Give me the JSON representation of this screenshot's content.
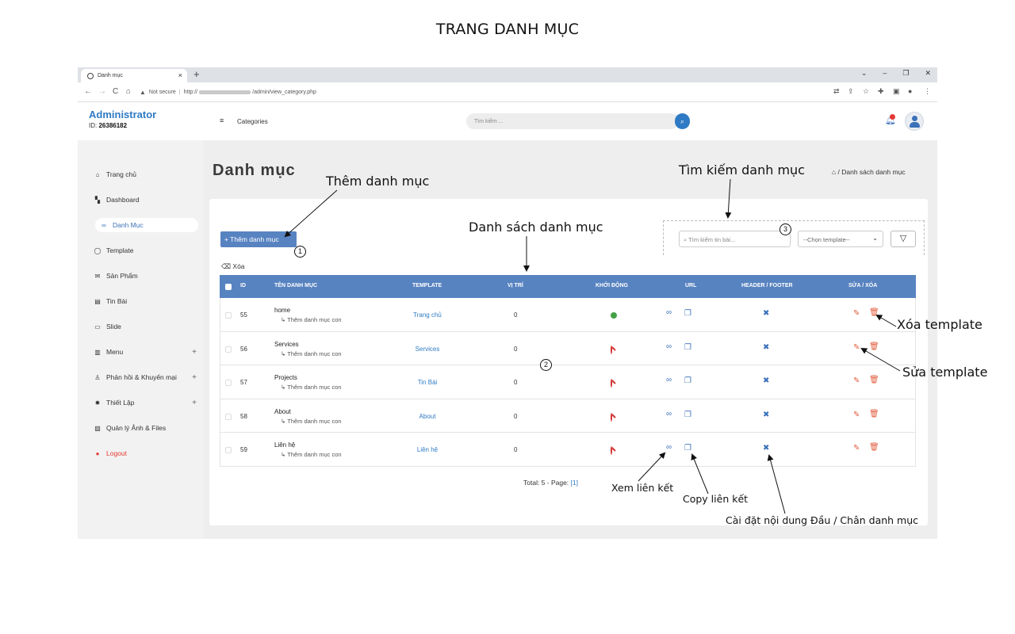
{
  "page_heading": "TRANG DANH MỤC",
  "browser": {
    "tab_title": "Danh mục",
    "tab_close": "×",
    "new_tab": "+",
    "window_controls": [
      "⌄",
      "–",
      "❐",
      "✕"
    ],
    "security": "Not secure",
    "url_prefix": "http://",
    "url_path": "/admin/view_category.php"
  },
  "header": {
    "admin_name": "Administrator",
    "admin_id_label": "ID:",
    "admin_id": "26386182",
    "section": "Categories",
    "search_placeholder": "Tìm kiếm ..."
  },
  "sidebar": {
    "items": [
      {
        "label": "Trang chủ",
        "icon": "home-icon"
      },
      {
        "label": "Dashboard",
        "icon": "dashboard-icon"
      },
      {
        "label": "Danh Mục",
        "icon": "link-icon",
        "active": true
      },
      {
        "label": "Template",
        "icon": "circle-icon"
      },
      {
        "label": "Sản Phẩm",
        "icon": "mail-icon"
      },
      {
        "label": "Tin Bài",
        "icon": "news-icon"
      },
      {
        "label": "Slide",
        "icon": "slide-icon"
      },
      {
        "label": "Menu",
        "icon": "menu-icon",
        "expand": "+"
      },
      {
        "label": "Phản hồi & Khuyến mại",
        "icon": "user-icon",
        "expand": "+"
      },
      {
        "label": "Thiết Lập",
        "icon": "gear-icon",
        "expand": "+"
      },
      {
        "label": "Quản lý Ảnh & Files",
        "icon": "images-icon"
      },
      {
        "label": "Logout",
        "icon": "logout-icon"
      }
    ]
  },
  "main": {
    "title": "Danh mục",
    "breadcrumb": "/ Danh sách danh mục",
    "add_button": "+ Thêm danh mục",
    "delete_label": "Xóa",
    "filter_search_placeholder": "Tìm kiếm tin bài...",
    "template_select": "--Chọn template--",
    "columns": [
      "ID",
      "TÊN DANH MỤC",
      "TEMPLATE",
      "VỊ TRÍ",
      "KHỞI ĐỘNG",
      "URL",
      "HEADER / FOOTER",
      "SỬA / XÓA"
    ],
    "sub_label": "↳ Thêm danh mục con",
    "rows": [
      {
        "id": "55",
        "name": "home",
        "template": "Trang chủ",
        "position": "0",
        "active": true
      },
      {
        "id": "56",
        "name": "Services",
        "template": "Services",
        "position": "0",
        "active": false
      },
      {
        "id": "57",
        "name": "Projects",
        "template": "Tin Bài",
        "position": "0",
        "active": false
      },
      {
        "id": "58",
        "name": "About",
        "template": "About",
        "position": "0",
        "active": false
      },
      {
        "id": "59",
        "name": "Liên hệ",
        "template": "Liên hệ",
        "position": "0",
        "active": false
      }
    ],
    "total_text": "Total: 5 - Page:",
    "page_link": "[1]"
  },
  "annotations": {
    "add": "Thêm danh mục",
    "list": "Danh sách danh mục",
    "search": "Tìm kiếm danh mục",
    "delete": "Xóa template",
    "edit": "Sửa template",
    "view_link": "Xem liên kết",
    "copy_link": "Copy liên kết",
    "header_footer": "Cài đặt nội dung Đầu / Chân danh mục",
    "n1": "1",
    "n2": "2",
    "n3": "3"
  },
  "colors": {
    "accent": "#5883c1",
    "brand": "#2f7ac4",
    "danger": "#e53935",
    "edit": "#e25c3c"
  }
}
